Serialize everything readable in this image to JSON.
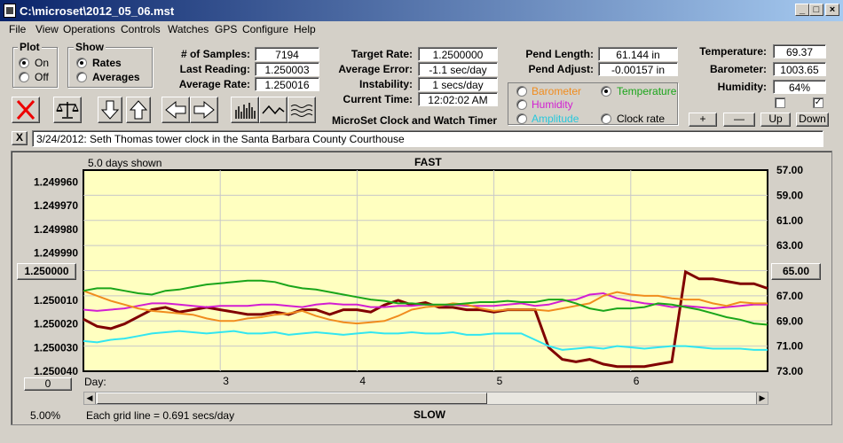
{
  "window": {
    "title": "C:\\microset\\2012_05_06.mst"
  },
  "menu": [
    "File",
    "View",
    "Operations",
    "Controls",
    "Watches",
    "GPS",
    "Configure",
    "Help"
  ],
  "plot": {
    "title": "Plot",
    "on": "On",
    "off": "Off",
    "selected": "On"
  },
  "show": {
    "title": "Show",
    "rates": "Rates",
    "averages": "Averages",
    "selected": "Rates"
  },
  "stats": {
    "samples_label": "# of Samples:",
    "samples": "7194",
    "last_label": "Last Reading:",
    "last": "1.250003",
    "avg_label": "Average Rate:",
    "avg": "1.250016"
  },
  "target": {
    "rate_label": "Target Rate:",
    "rate": "1.2500000",
    "err_label": "Average Error:",
    "err": "-1.1 sec/day",
    "inst_label": "Instability:",
    "inst": "1 secs/day",
    "time_label": "Current Time:",
    "time": "12:02:02 AM",
    "app_name": "MicroSet Clock and Watch Timer"
  },
  "pend": {
    "len_label": "Pend Length:",
    "len": "61.144 in",
    "adj_label": "Pend Adjust:",
    "adj": "-0.00157 in"
  },
  "sensors": {
    "barometer": "Barometer",
    "temperature": "Temperature",
    "humidity": "Humidity",
    "amplitude": "Amplitude",
    "clock_rate": "Clock rate",
    "selected": "Temperature"
  },
  "env": {
    "temp_label": "Temperature:",
    "temp": "69.37",
    "baro_label": "Barometer:",
    "baro": "1003.65",
    "hum_label": "Humidity:",
    "hum": "64%"
  },
  "buttons": {
    "plus": "+",
    "minus": "—",
    "up": "Up",
    "down": "Down"
  },
  "note": "3/24/2012: Seth Thomas tower clock in the Santa Barbara County Courthouse",
  "close_note": "X",
  "chart_top": {
    "days_shown": "5.0 days shown",
    "fast": "FAST"
  },
  "chart_bottom": {
    "percent": "5.00%",
    "grid": "Each grid line = 0.691 secs/day",
    "slow": "SLOW"
  },
  "left_center": "1.250000",
  "right_center": "65.00",
  "offset_btn": "0",
  "day_label": "Day:",
  "colors": {
    "bg": "#ffffc0",
    "rate": "#800000",
    "temp": "#1aa51a",
    "baro": "#f08c1e",
    "hum": "#d21ed2",
    "amp": "#32e6f0"
  },
  "chart_data": {
    "type": "line",
    "x": [
      2.0,
      2.1,
      2.2,
      2.3,
      2.4,
      2.5,
      2.6,
      2.7,
      2.8,
      2.9,
      3.0,
      3.1,
      3.2,
      3.3,
      3.4,
      3.5,
      3.6,
      3.7,
      3.8,
      3.9,
      4.0,
      4.1,
      4.2,
      4.3,
      4.4,
      4.5,
      4.6,
      4.7,
      4.8,
      4.9,
      5.0,
      5.1,
      5.2,
      5.3,
      5.4,
      5.5,
      5.6,
      5.7,
      5.8,
      5.9,
      6.0,
      6.1,
      6.2,
      6.3,
      6.4,
      6.5,
      6.6,
      6.7,
      6.8,
      6.9,
      7.0
    ],
    "xlim": [
      2.0,
      7.0
    ],
    "x_ticks": [
      3,
      4,
      5,
      6
    ],
    "left_axis": {
      "ylim": [
        1.25004,
        1.249955
      ],
      "ticks": [
        "1.249960",
        "1.249970",
        "1.249980",
        "1.249990",
        "1.250000",
        "1.250010",
        "1.250020",
        "1.250030",
        "1.250040"
      ]
    },
    "right_axis": {
      "ylim": [
        57.0,
        73.0
      ],
      "ticks": [
        "73.00",
        "71.00",
        "69.00",
        "67.00",
        "65.00",
        "63.00",
        "61.00",
        "59.00",
        "57.00"
      ]
    },
    "series": [
      {
        "axis": "left",
        "color": "#800000",
        "values": [
          1.250018,
          1.250021,
          1.250022,
          1.25002,
          1.250017,
          1.250014,
          1.250013,
          1.250015,
          1.250014,
          1.250013,
          1.250014,
          1.250015,
          1.250016,
          1.250016,
          1.250015,
          1.250016,
          1.250014,
          1.250014,
          1.250016,
          1.250014,
          1.250014,
          1.250015,
          1.250012,
          1.25001,
          1.250012,
          1.250011,
          1.250013,
          1.250013,
          1.250014,
          1.250014,
          1.250015,
          1.250014,
          1.250014,
          1.250014,
          1.25003,
          1.250035,
          1.250036,
          1.250035,
          1.250037,
          1.250038,
          1.250038,
          1.250038,
          1.250037,
          1.250036,
          1.249998,
          1.250001,
          1.250001,
          1.250002,
          1.250003,
          1.250003,
          1.250005
        ]
      },
      {
        "axis": "right",
        "color": "#32e6f0",
        "values": [
          70.6,
          70.7,
          70.5,
          70.4,
          70.2,
          70.0,
          69.9,
          69.8,
          69.9,
          70.0,
          69.9,
          69.8,
          70.0,
          70.0,
          69.9,
          70.1,
          70.0,
          69.9,
          70.0,
          70.1,
          70.0,
          69.9,
          70.0,
          70.0,
          69.9,
          70.0,
          70.0,
          69.9,
          70.1,
          70.1,
          70.0,
          70.0,
          70.0,
          70.5,
          71.0,
          71.3,
          71.2,
          71.1,
          71.2,
          71.0,
          71.1,
          71.2,
          71.1,
          71.0,
          71.0,
          71.1,
          71.2,
          71.2,
          71.2,
          71.3,
          71.3
        ]
      },
      {
        "axis": "right",
        "color": "#d21ed2",
        "values": [
          68.1,
          68.2,
          68.1,
          68.0,
          67.8,
          67.6,
          67.6,
          67.7,
          67.8,
          67.9,
          67.8,
          67.8,
          67.8,
          67.7,
          67.7,
          67.8,
          67.9,
          67.7,
          67.6,
          67.7,
          67.7,
          67.9,
          67.9,
          67.8,
          67.8,
          67.7,
          67.8,
          67.7,
          67.8,
          67.8,
          67.8,
          67.7,
          67.6,
          67.8,
          67.7,
          67.4,
          67.3,
          66.9,
          66.8,
          67.2,
          67.4,
          67.6,
          67.7,
          67.9,
          67.8,
          67.9,
          68.0,
          67.9,
          67.8,
          67.7,
          67.7
        ]
      },
      {
        "axis": "right",
        "color": "#f08c1e",
        "values": [
          66.6,
          67.0,
          67.4,
          67.7,
          68.0,
          68.2,
          68.3,
          68.4,
          68.5,
          68.8,
          69.0,
          69.0,
          68.8,
          68.7,
          68.5,
          68.4,
          68.2,
          68.6,
          68.9,
          69.1,
          69.2,
          69.1,
          69.0,
          68.6,
          68.1,
          67.9,
          67.8,
          67.6,
          67.7,
          68.0,
          68.2,
          68.1,
          68.1,
          68.1,
          68.2,
          68.0,
          67.8,
          67.6,
          67.0,
          66.7,
          66.9,
          67.0,
          67.0,
          67.2,
          67.3,
          67.3,
          67.6,
          67.8,
          67.5,
          67.6,
          67.6
        ]
      },
      {
        "axis": "right",
        "color": "#1aa51a",
        "values": [
          66.6,
          66.4,
          66.4,
          66.6,
          66.8,
          66.9,
          66.6,
          66.5,
          66.3,
          66.1,
          66.0,
          65.9,
          65.8,
          65.8,
          65.9,
          66.2,
          66.4,
          66.5,
          66.7,
          66.9,
          67.1,
          67.3,
          67.4,
          67.6,
          67.6,
          67.7,
          67.7,
          67.7,
          67.6,
          67.5,
          67.5,
          67.4,
          67.5,
          67.5,
          67.3,
          67.3,
          67.6,
          68.0,
          68.2,
          68.0,
          68.0,
          67.9,
          67.6,
          67.7,
          67.9,
          68.1,
          68.4,
          68.7,
          68.9,
          69.2,
          69.3
        ]
      }
    ]
  }
}
